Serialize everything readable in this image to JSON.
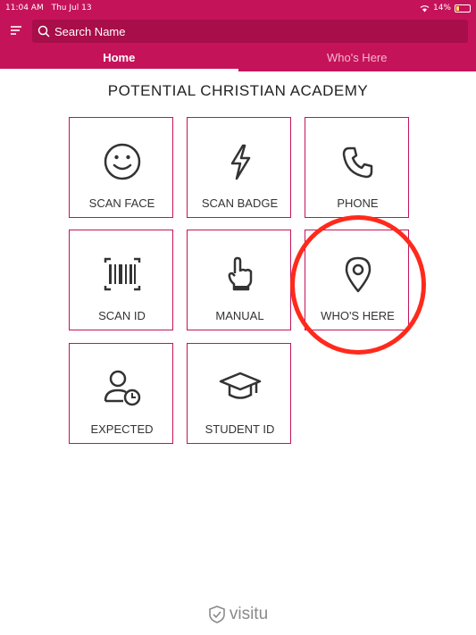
{
  "status_bar": {
    "time": "11:04 AM",
    "date": "Thu Jul 13",
    "battery": "14%"
  },
  "search": {
    "placeholder": "Search Name"
  },
  "tabs": [
    {
      "label": "Home",
      "active": true
    },
    {
      "label": "Who's Here",
      "active": false
    }
  ],
  "org_title": "POTENTIAL CHRISTIAN ACADEMY",
  "tiles": [
    {
      "label": "SCAN FACE",
      "icon": "smiley-face-icon"
    },
    {
      "label": "SCAN BADGE",
      "icon": "lightning-bolt-icon"
    },
    {
      "label": "PHONE",
      "icon": "phone-icon"
    },
    {
      "label": "SCAN ID",
      "icon": "barcode-icon"
    },
    {
      "label": "MANUAL",
      "icon": "pointing-hand-icon"
    },
    {
      "label": "WHO'S HERE",
      "icon": "map-pin-icon"
    },
    {
      "label": "EXPECTED",
      "icon": "person-clock-icon"
    },
    {
      "label": "STUDENT ID",
      "icon": "graduation-cap-icon"
    }
  ],
  "brand": "visitu",
  "colors": {
    "primary": "#c5135a",
    "search_bg": "#a80e49",
    "highlight": "#ff2a1c"
  }
}
